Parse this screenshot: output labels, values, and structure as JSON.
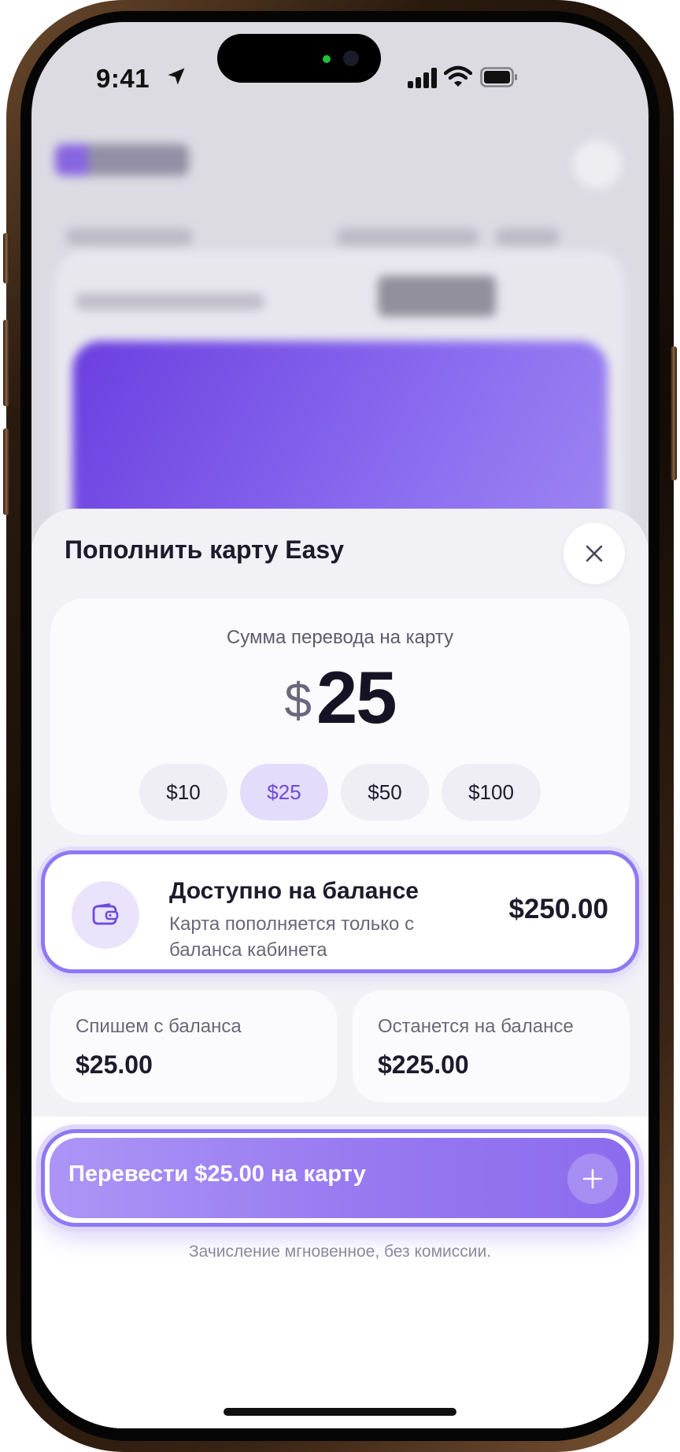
{
  "status_bar": {
    "time": "9:41"
  },
  "sheet": {
    "title": "Пополнить карту Easy",
    "amount_label": "Сумма перевода на карту",
    "currency_symbol": "$",
    "amount_value": "25",
    "presets": [
      {
        "label": "$10",
        "selected": false
      },
      {
        "label": "$25",
        "selected": true
      },
      {
        "label": "$50",
        "selected": false
      },
      {
        "label": "$100",
        "selected": false
      }
    ],
    "balance": {
      "title": "Доступно на балансе",
      "subtitle": "Карта пополняется только с баланса кабинета",
      "amount": "$250.00"
    },
    "debit": {
      "label": "Спишем с баланса",
      "value": "$25.00"
    },
    "remaining": {
      "label": "Останется на балансе",
      "value": "$225.00"
    },
    "cta_label": "Перевести $25.00 на карту",
    "footnote": "Зачисление мгновенное, без комиссии."
  },
  "colors": {
    "accent": "#8f78f4",
    "accent_soft": "#e3dcfb",
    "text": "#1c1a2b"
  },
  "icons": [
    "location-arrow-icon",
    "signal-icon",
    "wifi-icon",
    "battery-icon",
    "close-icon",
    "wallet-icon",
    "plus-icon"
  ]
}
